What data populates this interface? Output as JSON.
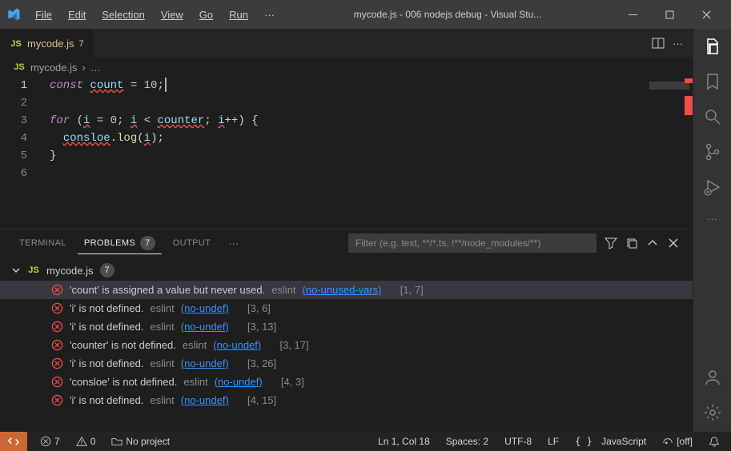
{
  "title_bar": {
    "title": "mycode.js - 006 nodejs debug - Visual Stu...",
    "menu": [
      "File",
      "Edit",
      "Selection",
      "View",
      "Go",
      "Run"
    ]
  },
  "tab": {
    "icon": "JS",
    "title": "mycode.js",
    "modified": "7"
  },
  "breadcrumb": {
    "icon": "JS",
    "file": "mycode.js",
    "sep": "›",
    "more": "…"
  },
  "code": {
    "lines": [
      {
        "n": "1",
        "tokens": [
          [
            "kw",
            "const"
          ],
          [
            "sp",
            " "
          ],
          [
            "vartok sq",
            "count"
          ],
          [
            "sp",
            " "
          ],
          [
            "op",
            "="
          ],
          [
            "sp",
            " "
          ],
          [
            "num",
            "10"
          ],
          [
            "op",
            ";"
          ],
          [
            "cursor",
            ""
          ]
        ]
      },
      {
        "n": "2",
        "tokens": []
      },
      {
        "n": "3",
        "tokens": [
          [
            "kw",
            "for"
          ],
          [
            "sp",
            " "
          ],
          [
            "op",
            "("
          ],
          [
            "vartok sq",
            "i"
          ],
          [
            "sp",
            " "
          ],
          [
            "op",
            "="
          ],
          [
            "sp",
            " "
          ],
          [
            "num",
            "0"
          ],
          [
            "op",
            ";"
          ],
          [
            "sp",
            " "
          ],
          [
            "vartok sq",
            "i"
          ],
          [
            "sp",
            " "
          ],
          [
            "op",
            "<"
          ],
          [
            "sp",
            " "
          ],
          [
            "vartok sq",
            "counter"
          ],
          [
            "op",
            ";"
          ],
          [
            "sp",
            " "
          ],
          [
            "vartok sq",
            "i"
          ],
          [
            "op",
            "++"
          ],
          [
            "op",
            ")"
          ],
          [
            "sp",
            " "
          ],
          [
            "op",
            "{"
          ]
        ]
      },
      {
        "n": "4",
        "tokens": [
          [
            "sp",
            "  "
          ],
          [
            "vartok sq",
            "consloe"
          ],
          [
            "op",
            "."
          ],
          [
            "fn",
            "log"
          ],
          [
            "op",
            "("
          ],
          [
            "vartok sq",
            "i"
          ],
          [
            "op",
            ")"
          ],
          [
            "op",
            ";"
          ]
        ]
      },
      {
        "n": "5",
        "tokens": [
          [
            "op",
            "}"
          ]
        ]
      },
      {
        "n": "6",
        "tokens": []
      }
    ],
    "active_line": "1"
  },
  "panel": {
    "tabs": {
      "terminal": "TERMINAL",
      "problems": "PROBLEMS",
      "problems_count": "7",
      "output": "OUTPUT"
    },
    "filter_placeholder": "Filter (e.g. text, **/*.ts, !**/node_modules/**)",
    "file": {
      "icon": "JS",
      "name": "mycode.js",
      "count": "7"
    },
    "problems": [
      {
        "msg": "'count' is assigned a value but never used.",
        "src": "eslint",
        "rule": "(no-unused-vars)",
        "loc": "[1, 7]",
        "selected": true
      },
      {
        "msg": "'i' is not defined.",
        "src": "eslint",
        "rule": "(no-undef)",
        "loc": "[3, 6]"
      },
      {
        "msg": "'i' is not defined.",
        "src": "eslint",
        "rule": "(no-undef)",
        "loc": "[3, 13]"
      },
      {
        "msg": "'counter' is not defined.",
        "src": "eslint",
        "rule": "(no-undef)",
        "loc": "[3, 17]"
      },
      {
        "msg": "'i' is not defined.",
        "src": "eslint",
        "rule": "(no-undef)",
        "loc": "[3, 26]"
      },
      {
        "msg": "'consloe' is not defined.",
        "src": "eslint",
        "rule": "(no-undef)",
        "loc": "[4, 3]"
      },
      {
        "msg": "'i' is not defined.",
        "src": "eslint",
        "rule": "(no-undef)",
        "loc": "[4, 15]"
      }
    ]
  },
  "status": {
    "errors": "7",
    "warnings": "0",
    "project": "No project",
    "ln_col": "Ln 1, Col 18",
    "spaces": "Spaces: 2",
    "encoding": "UTF-8",
    "eol": "LF",
    "lang": "JavaScript",
    "inspect": "[off]"
  }
}
